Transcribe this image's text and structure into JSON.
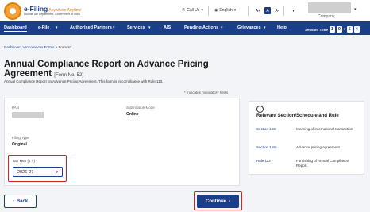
{
  "header": {
    "logo_title": "e-Filing",
    "logo_subtitle": "Anywhere Anytime",
    "logo_caption": "Income Tax Department, Government of India",
    "call_us": "Call Us",
    "language": "English",
    "font_increase": "A+",
    "font_default": "A",
    "font_decrease": "A-",
    "contrast_icon": "contrast-icon",
    "company": "Company"
  },
  "nav": {
    "items": [
      "Dashboard",
      "e-File",
      "Authorised Partners",
      "Services",
      "AIS",
      "Pending Actions",
      "Grievances",
      "Help"
    ],
    "session_label": "Session Time",
    "session_digits": [
      "1",
      "9",
      "5",
      "4"
    ]
  },
  "breadcrumb": {
    "items": [
      "Dashboard",
      "Income-tax Forms"
    ],
    "current": "Form 52"
  },
  "page": {
    "title": "Annual Compliance Report on Advance Pricing Agreement",
    "form_tag": "[Form No. 52]",
    "description": "Annual Compliance Report on Advance Pricing Agreement. This form is in compliance with Rule 113.",
    "mandatory_note": "* Indicates mandatory fields"
  },
  "form": {
    "pan_label": "PAN",
    "submission_mode_label": "Submission Mode",
    "submission_mode_value": "Online",
    "filing_type_label": "Filing Type",
    "filing_type_value": "Original",
    "tax_year_label": "Tax Year (T.Y) *",
    "tax_year_value": "2026-27"
  },
  "side": {
    "title": "Relevant Section/Schedule and Rule",
    "rows": [
      {
        "link": "Section 163 -",
        "desc": "Meaning of international transaction"
      },
      {
        "link": "Section 168 -",
        "desc": "Advance pricing agreement"
      },
      {
        "link": "Rule 113 -",
        "desc": "Furnishing of Annual Compliance Report."
      }
    ]
  },
  "footer": {
    "back_label": "Back",
    "continue_label": "Continue"
  },
  "colors": {
    "brand": "#1b3e8a",
    "highlight": "#d42222",
    "accent": "#e57f00"
  }
}
